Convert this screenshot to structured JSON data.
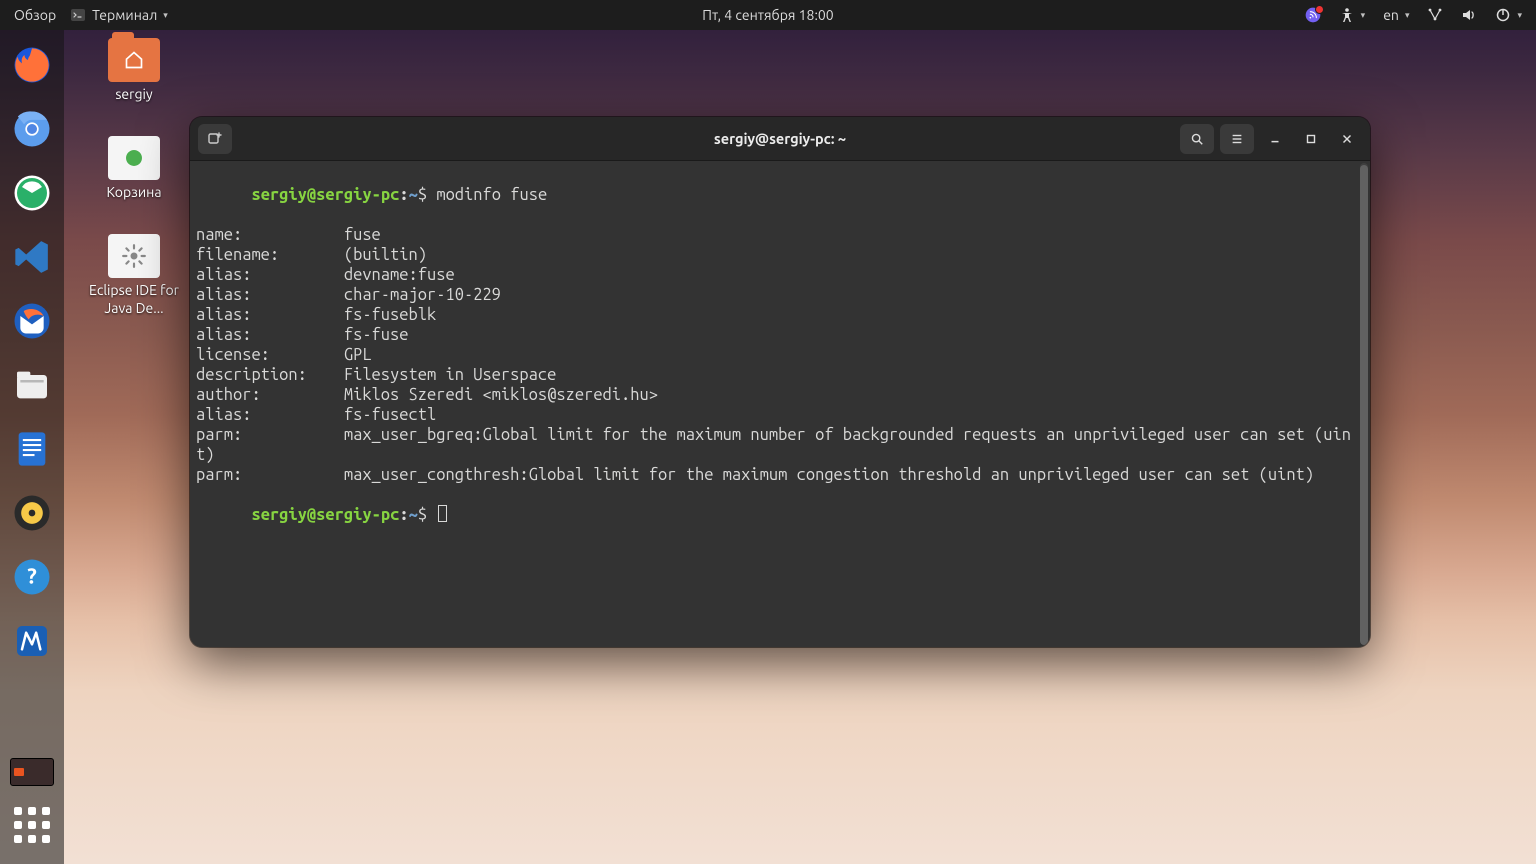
{
  "topbar": {
    "activities": "Обзор",
    "appmenu": "Терминал",
    "clock": "Пт, 4 сентября  18:00",
    "input_lang": "en"
  },
  "desktop_icons": {
    "home": "sergiy",
    "trash": "Корзина",
    "eclipse": "Eclipse IDE for Java De..."
  },
  "terminal": {
    "title": "sergiy@sergiy-pc: ~",
    "prompt": {
      "user": "sergiy",
      "host": "sergiy-pc",
      "path": "~",
      "symbol": "$"
    },
    "command": "modinfo fuse",
    "output": "name:           fuse\nfilename:       (builtin)\nalias:          devname:fuse\nalias:          char-major-10-229\nalias:          fs-fuseblk\nalias:          fs-fuse\nlicense:        GPL\ndescription:    Filesystem in Userspace\nauthor:         Miklos Szeredi <miklos@szeredi.hu>\nalias:          fs-fusectl\nparm:           max_user_bgreq:Global limit for the maximum number of backgrounded requests an unprivileged user can set (uint)\nparm:           max_user_congthresh:Global limit for the maximum congestion threshold an unprivileged user can set (uint)"
  }
}
